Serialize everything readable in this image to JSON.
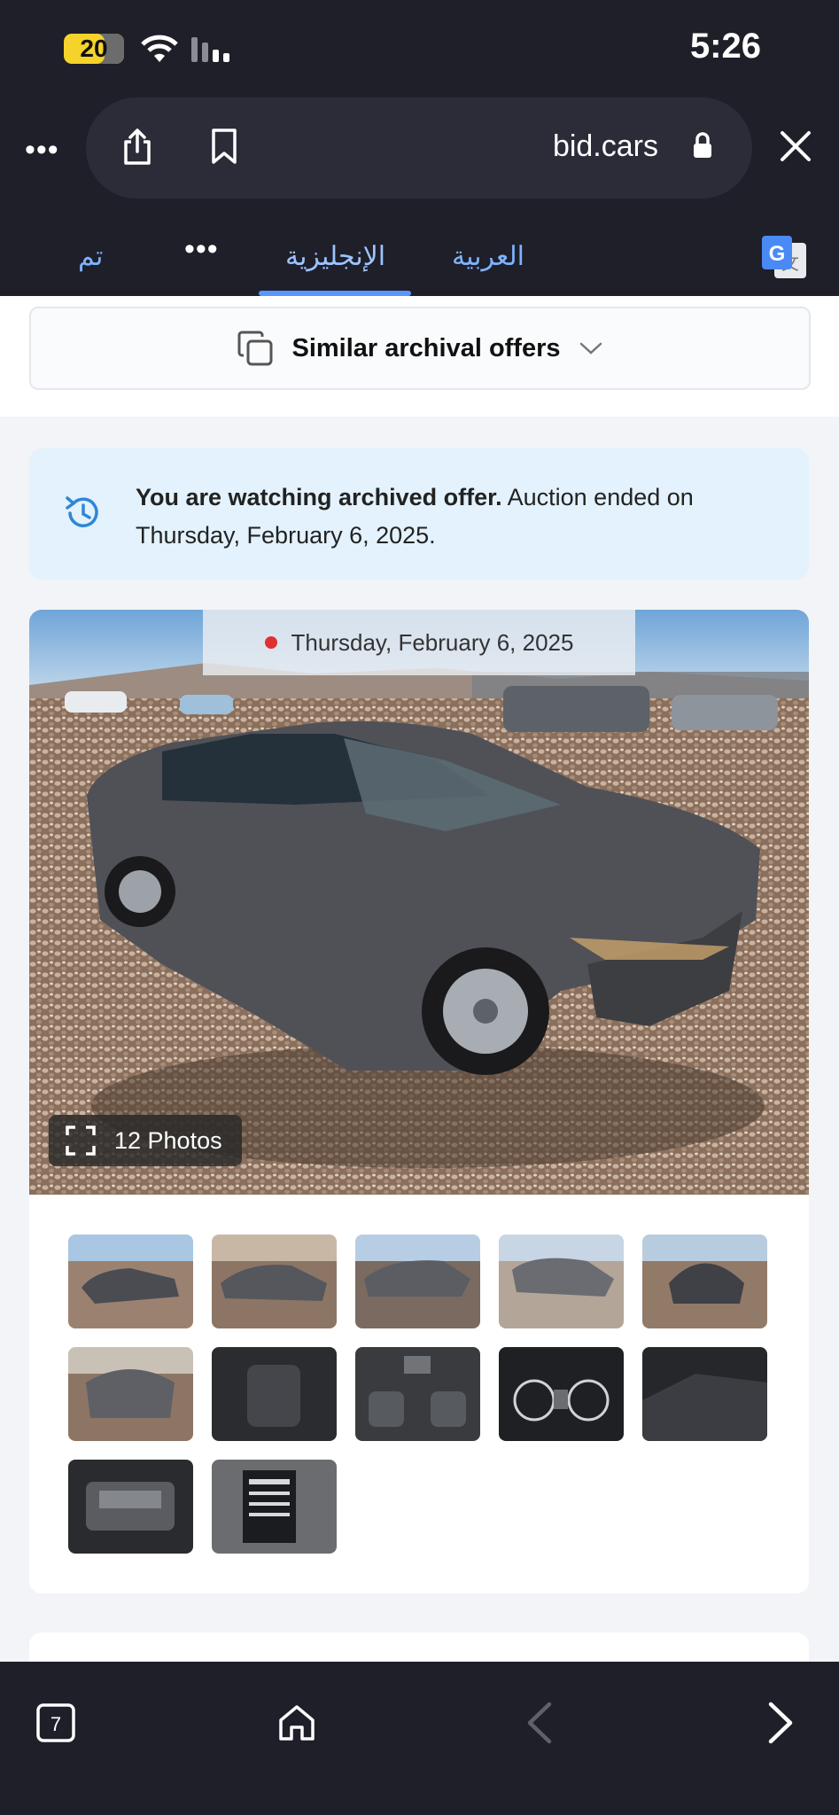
{
  "status_bar": {
    "battery": "20",
    "time": "5:26"
  },
  "toolbar": {
    "url": "bid.cars"
  },
  "translate_bar": {
    "done": "تم",
    "english": "الإنجليزية",
    "arabic": "العربية"
  },
  "similar": {
    "label": "Similar archival offers"
  },
  "archived_notice": {
    "bold": "You are watching archived offer.",
    "text": " Auction ended on Thursday, February 6, 2025."
  },
  "gallery": {
    "date": "Thursday, February 6, 2025",
    "photos_label": "12 Photos",
    "thumbnails": [
      "front-left-view",
      "left-side-view",
      "rear-left-view",
      "right-side-view",
      "front-view",
      "rear-view",
      "driver-interior",
      "dashboard-center",
      "instrument-cluster",
      "rear-interior",
      "engine-bay",
      "door-label"
    ]
  },
  "bottom_bar": {
    "tab_count": "7"
  },
  "colors": {
    "accent": "#5b95ff",
    "notice_bg": "#e3f2fd",
    "dark": "#1f1f29"
  }
}
